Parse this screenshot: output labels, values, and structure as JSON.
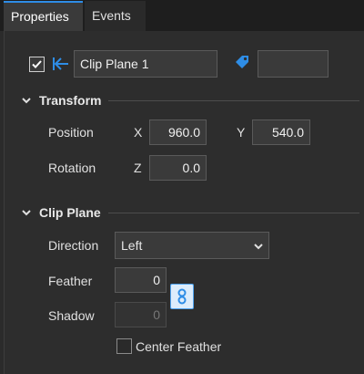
{
  "tabs": [
    {
      "label": "Properties"
    },
    {
      "label": "Events"
    }
  ],
  "header": {
    "name_value": "Clip Plane 1",
    "tag_value": ""
  },
  "transform": {
    "title": "Transform",
    "position_label": "Position",
    "x_label": "X",
    "x_value": "960.0",
    "y_label": "Y",
    "y_value": "540.0",
    "rotation_label": "Rotation",
    "z_label": "Z",
    "z_value": "0.0"
  },
  "clip_plane": {
    "title": "Clip Plane",
    "direction_label": "Direction",
    "direction_value": "Left",
    "feather_label": "Feather",
    "feather_value": "0",
    "shadow_label": "Shadow",
    "shadow_value": "0",
    "center_feather_label": "Center Feather",
    "center_feather_checked": false
  },
  "colors": {
    "accent": "#2e8de6",
    "background": "#2d2d2d",
    "input": "#3a3a3a"
  },
  "icons": [
    "checkmark-icon",
    "arrow-left-icon",
    "tag-icon",
    "chevron-down-icon",
    "link-icon"
  ]
}
